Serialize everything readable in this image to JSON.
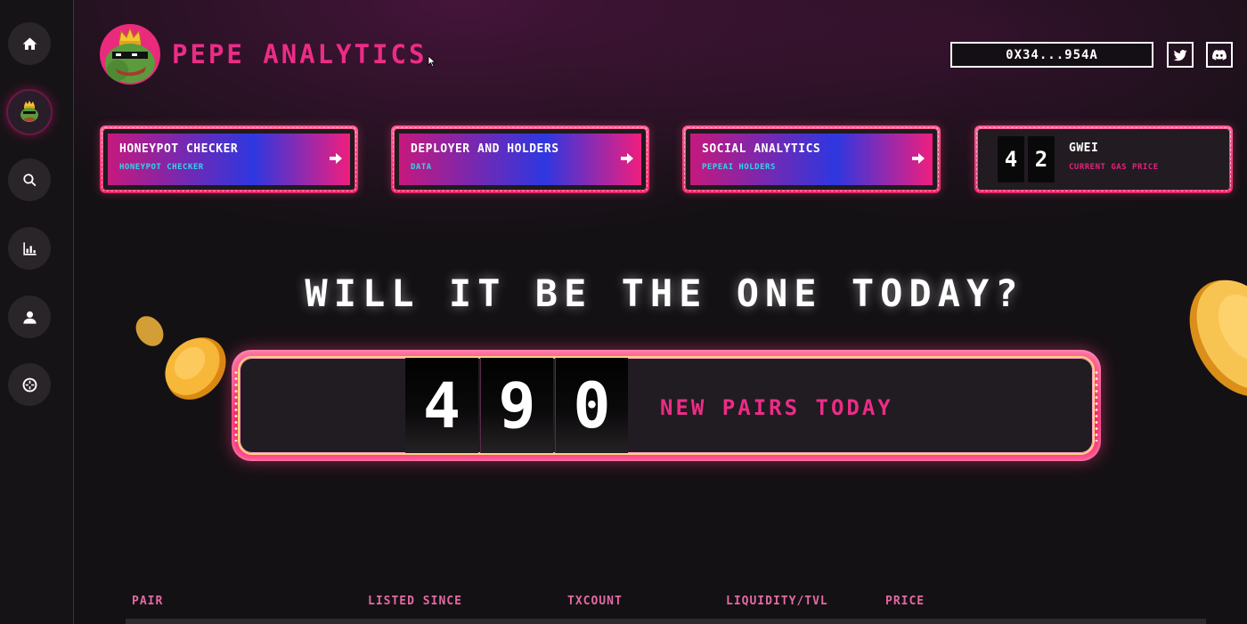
{
  "app": {
    "brand_name": "PEPE ANALYTICS",
    "accent_color": "#ec2c86",
    "cyan_color": "#2fd6e8"
  },
  "sidebar": {
    "items": [
      {
        "name": "home",
        "icon": "home-icon"
      },
      {
        "name": "pepe",
        "icon": "pepe-avatar-icon",
        "active": true
      },
      {
        "name": "search",
        "icon": "search-icon"
      },
      {
        "name": "analytics",
        "icon": "bar-chart-icon"
      },
      {
        "name": "profile",
        "icon": "user-icon"
      },
      {
        "name": "target",
        "icon": "crosshair-icon"
      }
    ]
  },
  "header": {
    "wallet_address": "0X34...954A",
    "social": [
      {
        "name": "twitter",
        "icon": "twitter-icon"
      },
      {
        "name": "discord",
        "icon": "discord-icon"
      }
    ]
  },
  "cards": [
    {
      "title": "HONEYPOT CHECKER",
      "subtitle": "HONEYPOT CHECKER",
      "icon": "arrow-right-icon"
    },
    {
      "title": "DEPLOYER AND HOLDERS",
      "subtitle": "DATA",
      "icon": "arrow-right-icon"
    },
    {
      "title": "SOCIAL ANALYTICS",
      "subtitle": "PEPEAI HOLDERS",
      "icon": "arrow-right-icon"
    }
  ],
  "gas": {
    "digits": [
      "4",
      "2"
    ],
    "label": "GWEI",
    "subtitle": "CURRENT GAS PRICE"
  },
  "hero": {
    "headline": "WILL IT BE THE ONE TODAY?",
    "digits": [
      "4",
      "9",
      "0"
    ],
    "label": "NEW PAIRS TODAY"
  },
  "table": {
    "columns": [
      "PAIR",
      "LISTED SINCE",
      "TXCOUNT",
      "LIQUIDITY/TVL",
      "PRICE"
    ]
  }
}
